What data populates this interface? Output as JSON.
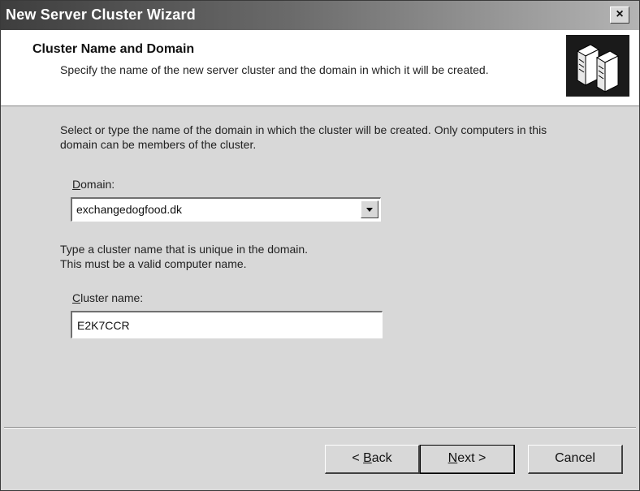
{
  "window": {
    "title": "New Server Cluster Wizard",
    "close_label": "×"
  },
  "header": {
    "title": "Cluster Name and Domain",
    "subtitle": "Specify the name of the new server cluster and the domain in which it will be created.",
    "icon": "cluster-servers-icon"
  },
  "body": {
    "domain_instructions": "Select or type the name of the domain in which the cluster will be created. Only computers in this domain can be members of the cluster.",
    "domain_label_accel": "D",
    "domain_label_rest": "omain:",
    "domain_value": "exchangedogfood.dk",
    "name_instructions_line1": "Type a cluster name that is unique in the domain.",
    "name_instructions_line2": "This must be a valid computer name.",
    "cluster_label_accel": "C",
    "cluster_label_rest": "luster name:",
    "cluster_name_value": "E2K7CCR"
  },
  "buttons": {
    "back_prefix": "< ",
    "back_accel": "B",
    "back_rest": "ack",
    "next_accel": "N",
    "next_rest": "ext >",
    "cancel": "Cancel"
  }
}
